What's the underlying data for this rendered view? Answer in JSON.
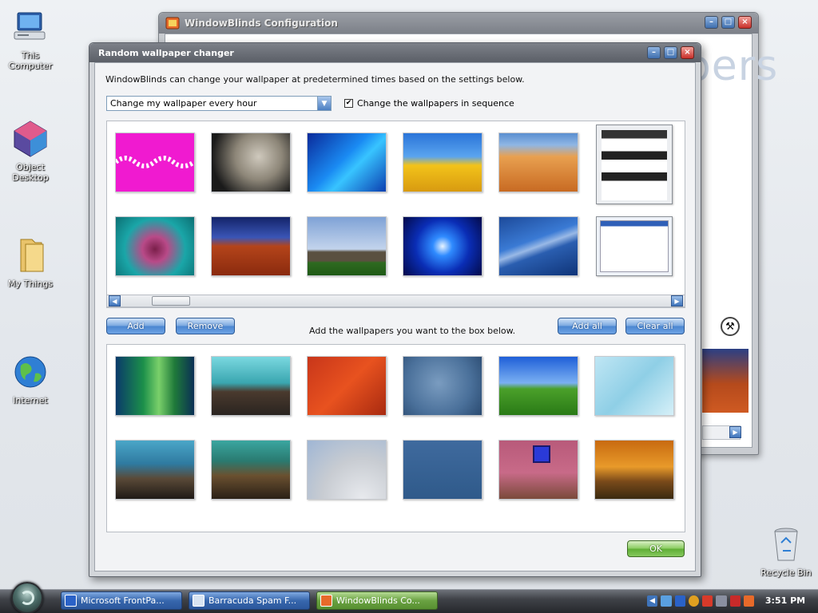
{
  "desktop": {
    "icons": [
      {
        "label": "This Computer"
      },
      {
        "label": "Object Desktop"
      },
      {
        "label": "My Things"
      },
      {
        "label": "Internet"
      },
      {
        "label": "Recycle Bin"
      }
    ]
  },
  "back_window": {
    "title": "WindowBlinds Configuration",
    "banner_text": "Wallpapers"
  },
  "dialog": {
    "title": "Random wallpaper changer",
    "intro": "WindowBlinds can change your wallpaper at predetermined times based on the settings below.",
    "interval_select": {
      "value": "Change my wallpaper every hour"
    },
    "sequence_checkbox": {
      "label": "Change the wallpapers in sequence",
      "checked": true
    },
    "buttons": {
      "add": "Add",
      "remove": "Remove",
      "add_all": "Add all",
      "clear_all": "Clear all",
      "ok": "OK"
    },
    "hint": "Add the wallpapers you want to the box below.",
    "available_wallpapers": [
      {
        "name": "magenta-pattern"
      },
      {
        "name": "moon-surface"
      },
      {
        "name": "blue-waves"
      },
      {
        "name": "yellow-tulips"
      },
      {
        "name": "sand-dune"
      },
      {
        "name": "screenshot-dialog"
      },
      {
        "name": "pink-flower"
      },
      {
        "name": "red-dunes-moon"
      },
      {
        "name": "stonehenge"
      },
      {
        "name": "blue-burst"
      },
      {
        "name": "xp-blue"
      },
      {
        "name": "screenshot-window"
      }
    ],
    "selected_wallpapers": [
      {
        "name": "vista-aurora"
      },
      {
        "name": "reef-arch"
      },
      {
        "name": "windows-red"
      },
      {
        "name": "blue-face"
      },
      {
        "name": "bliss"
      },
      {
        "name": "light-blue"
      },
      {
        "name": "reef-1"
      },
      {
        "name": "reef-2"
      },
      {
        "name": "ufo-moon"
      },
      {
        "name": "blue-plain"
      },
      {
        "name": "pink-wall-window"
      },
      {
        "name": "autumn-path"
      }
    ]
  },
  "taskbar": {
    "tasks": [
      {
        "label": "Microsoft FrontPa...",
        "active": false
      },
      {
        "label": "Barracuda Spam F...",
        "active": false
      },
      {
        "label": "WindowBlinds Co...",
        "active": true
      }
    ],
    "clock": "3:51 PM"
  },
  "colors": {
    "task_blue": "#3767ad",
    "task_green": "#6aa242",
    "button_blue": "#4b86d1"
  }
}
